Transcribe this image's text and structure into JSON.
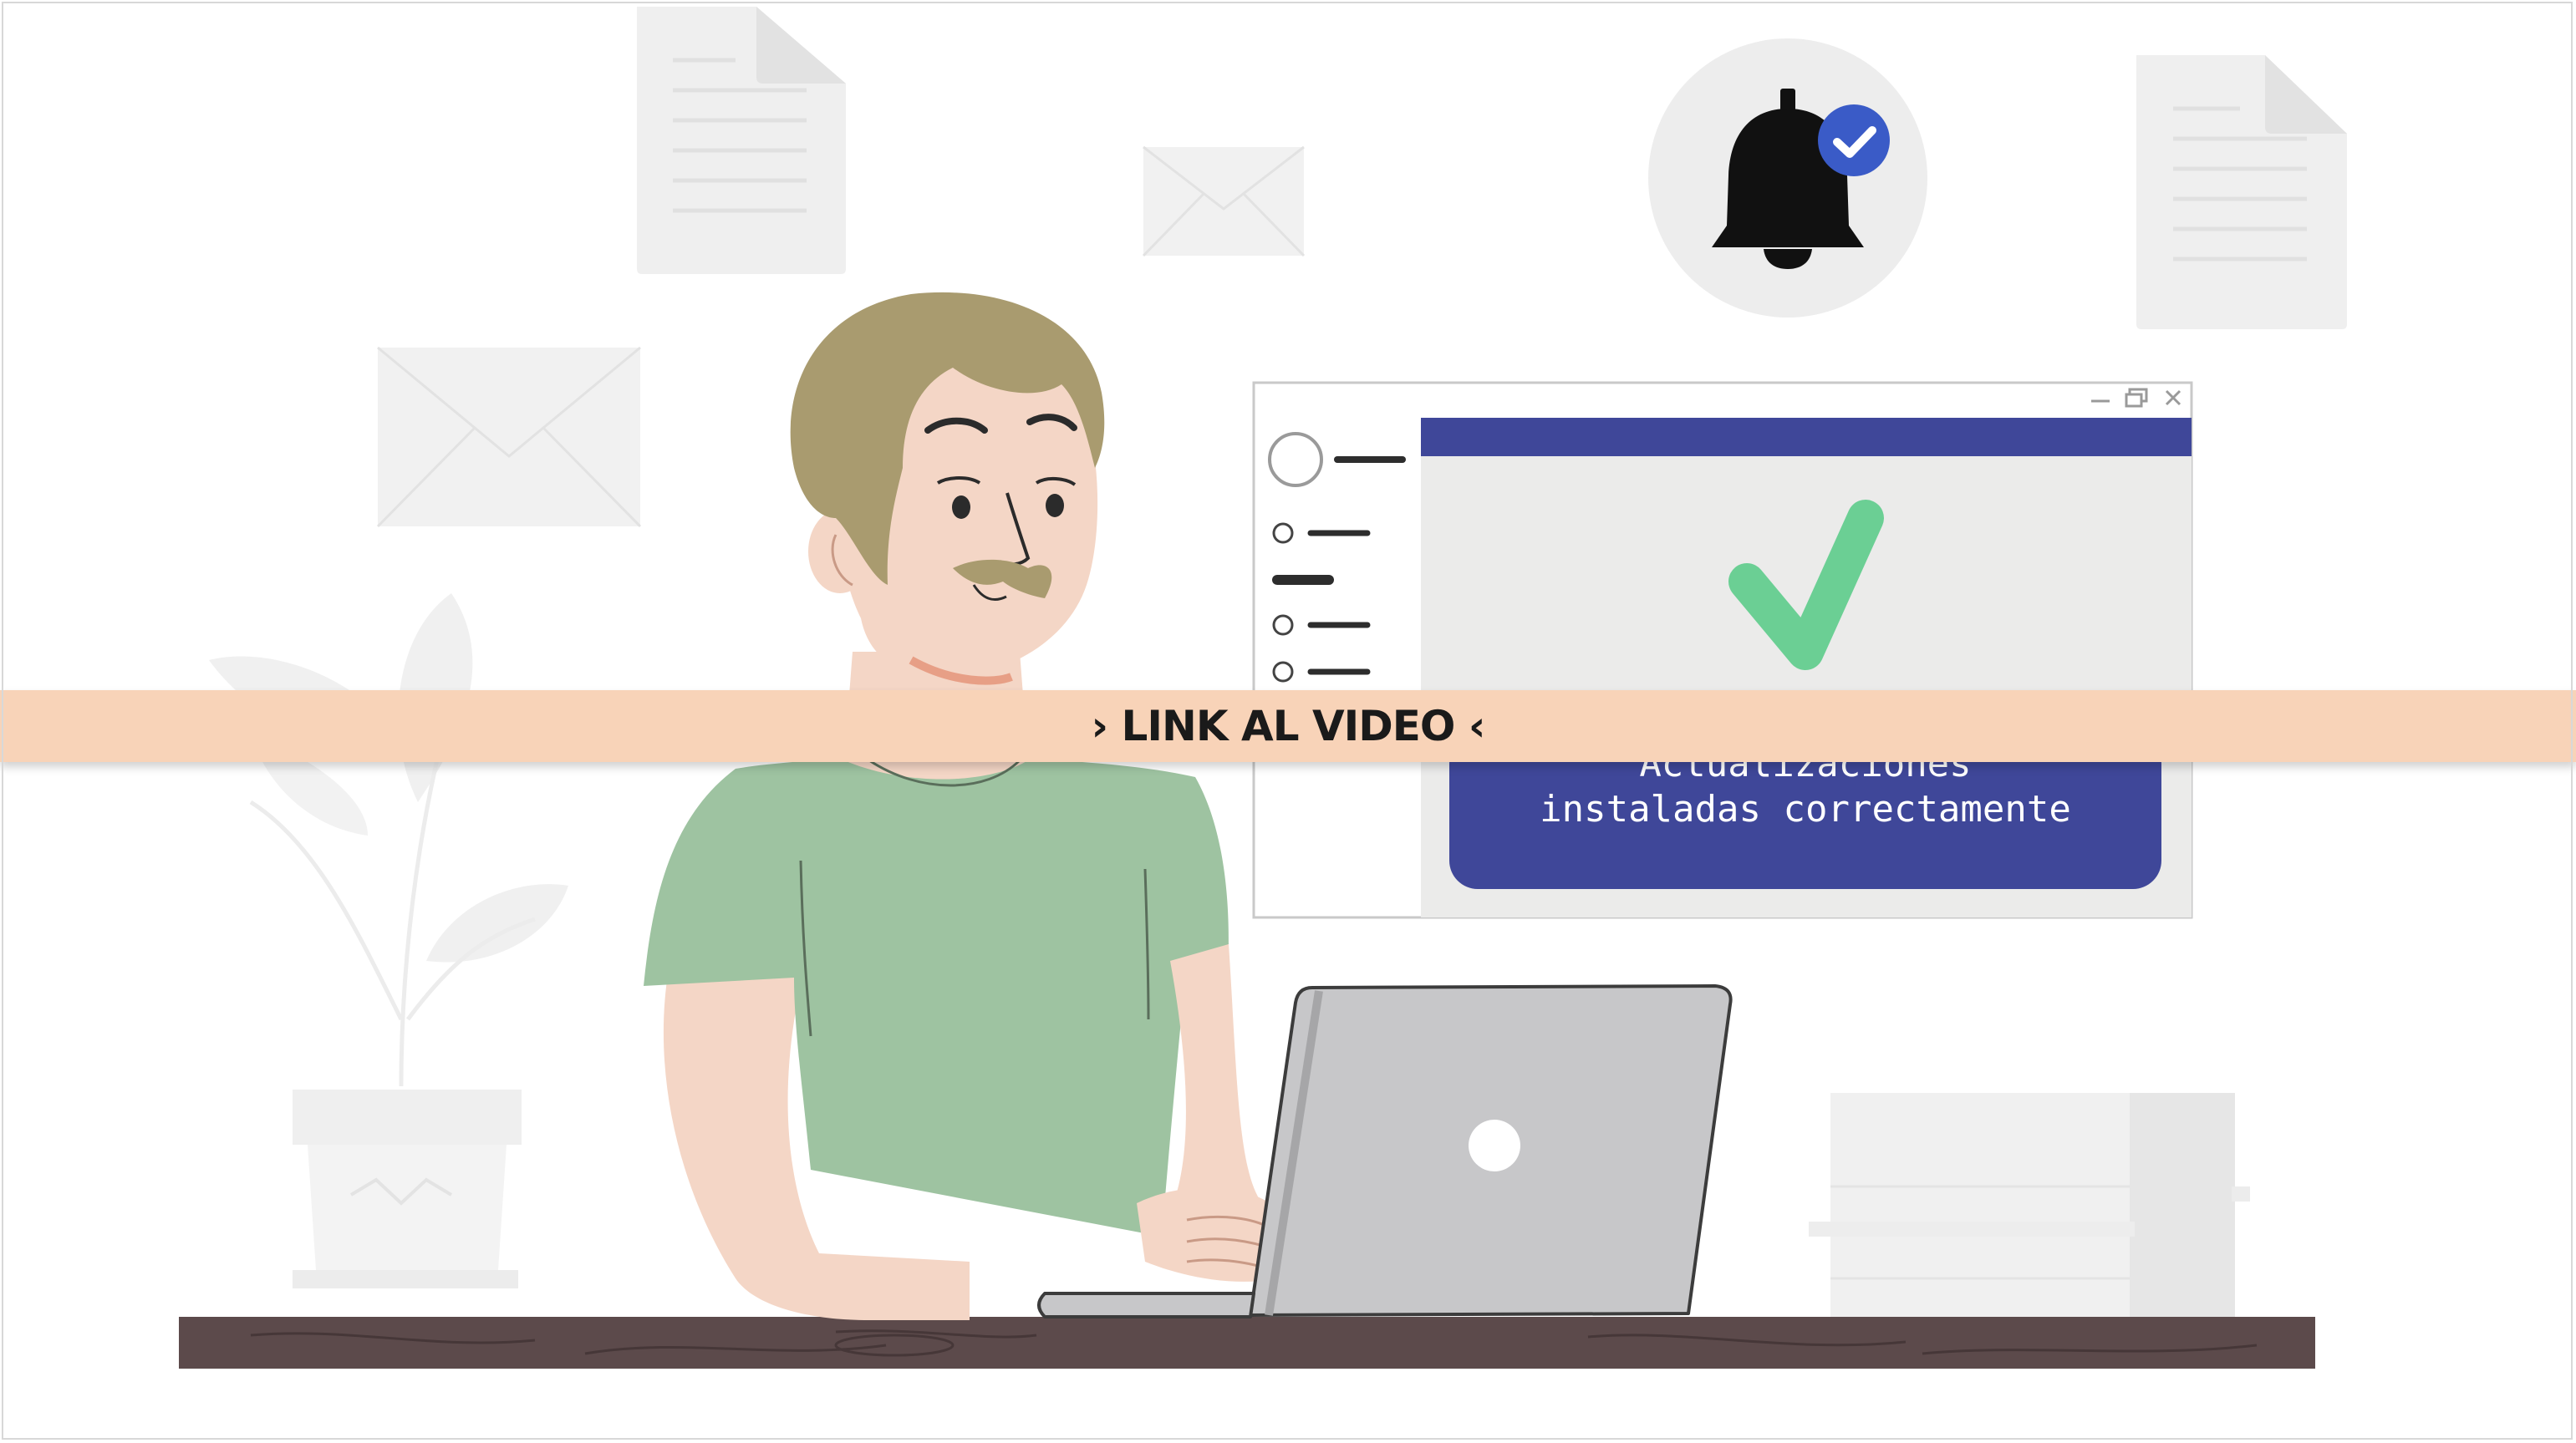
{
  "banner": {
    "label": "› LINK AL VIDEO ‹"
  },
  "dialog": {
    "message_line1": "Actualizaciones",
    "message_line2": "instaladas correctamente",
    "window_controls": [
      "minimize-icon",
      "restore-icon",
      "close-icon"
    ]
  },
  "notification": {
    "icon": "bell-icon",
    "badge_icon": "checkmark-badge-icon"
  },
  "colors": {
    "banner": "#f8d3b8",
    "dialog_header": "#3f4799",
    "success_check": "#6bcf94",
    "shirt": "#9ec3a1",
    "desk": "#5c4a4b",
    "laptop": "#c7c7c9"
  }
}
